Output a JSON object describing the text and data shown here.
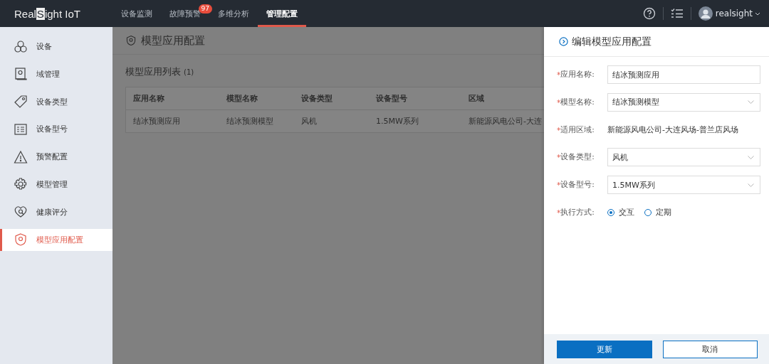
{
  "logo": {
    "before": "Real",
    "mark": "S",
    "after": "ight IoT"
  },
  "nav": [
    {
      "label": "设备监测",
      "selected": false
    },
    {
      "label": "故障预警",
      "selected": false,
      "badge": "97"
    },
    {
      "label": "多维分析",
      "selected": false
    },
    {
      "label": "管理配置",
      "selected": true
    }
  ],
  "user": {
    "name": "realsight"
  },
  "sidebar": {
    "items": [
      {
        "label": "设备",
        "selected": false
      },
      {
        "label": "域管理",
        "selected": false
      },
      {
        "label": "设备类型",
        "selected": false
      },
      {
        "label": "设备型号",
        "selected": false
      },
      {
        "label": "预警配置",
        "selected": false
      },
      {
        "label": "模型管理",
        "selected": false
      },
      {
        "label": "健康评分",
        "selected": false
      },
      {
        "label": "模型应用配置",
        "selected": true
      }
    ]
  },
  "page": {
    "title": "模型应用配置",
    "list_title": "模型应用列表",
    "count": "(1)"
  },
  "table": {
    "columns": [
      "应用名称",
      "模型名称",
      "设备类型",
      "设备型号",
      "区域"
    ],
    "rows": [
      [
        "结冰预测应用",
        "结冰预测模型",
        "风机",
        "1.5MW系列",
        "新能源风电公司-大连"
      ]
    ]
  },
  "drawer": {
    "title": "编辑模型应用配置",
    "fields": [
      {
        "kind": "input",
        "label": "应用名称:",
        "marker": "*",
        "value": "结冰预测应用"
      },
      {
        "kind": "select",
        "label": "模型名称:",
        "marker": "*",
        "value": "结冰预测模型"
      },
      {
        "kind": "text",
        "label": "适用区域:",
        "marker": "*",
        "value": "新能源风电公司-大连风场-普兰店风场"
      },
      {
        "kind": "select",
        "label": "设备类型:",
        "marker": "*",
        "value": "风机"
      },
      {
        "kind": "select",
        "label": "设备型号:",
        "marker": "*",
        "value": "1.5MW系列"
      },
      {
        "kind": "radio",
        "label": "执行方式:",
        "marker": "*",
        "options": [
          {
            "label": "交互",
            "selected": true
          },
          {
            "label": "定期",
            "selected": false
          }
        ]
      }
    ],
    "buttons": [
      {
        "kind": "primary",
        "label": "更新"
      },
      {
        "kind": "secondary",
        "label": "取消"
      }
    ]
  }
}
